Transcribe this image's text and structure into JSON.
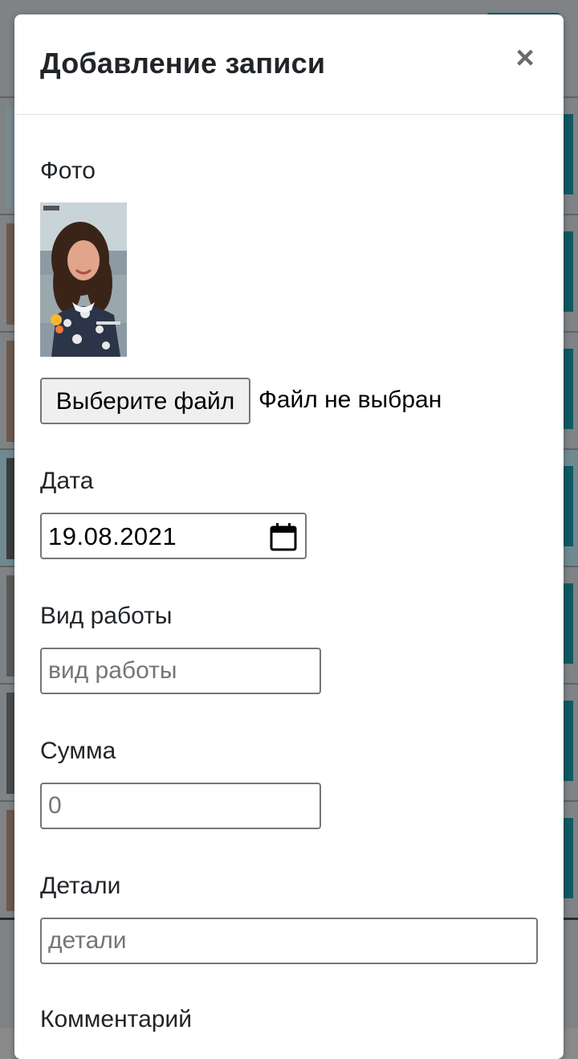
{
  "modal": {
    "title": "Добавление записи",
    "close_glyph": "×"
  },
  "form": {
    "photo_label": "Фото",
    "file_button_label": "Выберите файл",
    "file_status": "Файл не выбран",
    "date_label": "Дата",
    "date_value": "19.08.2021",
    "work_label": "Вид работы",
    "work_placeholder": "вид работы",
    "sum_label": "Сумма",
    "sum_placeholder": "0",
    "details_label": "Детали",
    "details_placeholder": "детали",
    "comment_label": "Комментарий"
  },
  "icons": {
    "close": "close-icon",
    "calendar": "calendar-icon",
    "photo": "photo-thumbnail"
  },
  "colors": {
    "overlay": "#7f8386",
    "accent_bg_button": "#0f5a63",
    "text": "#212529",
    "border": "#767676"
  }
}
